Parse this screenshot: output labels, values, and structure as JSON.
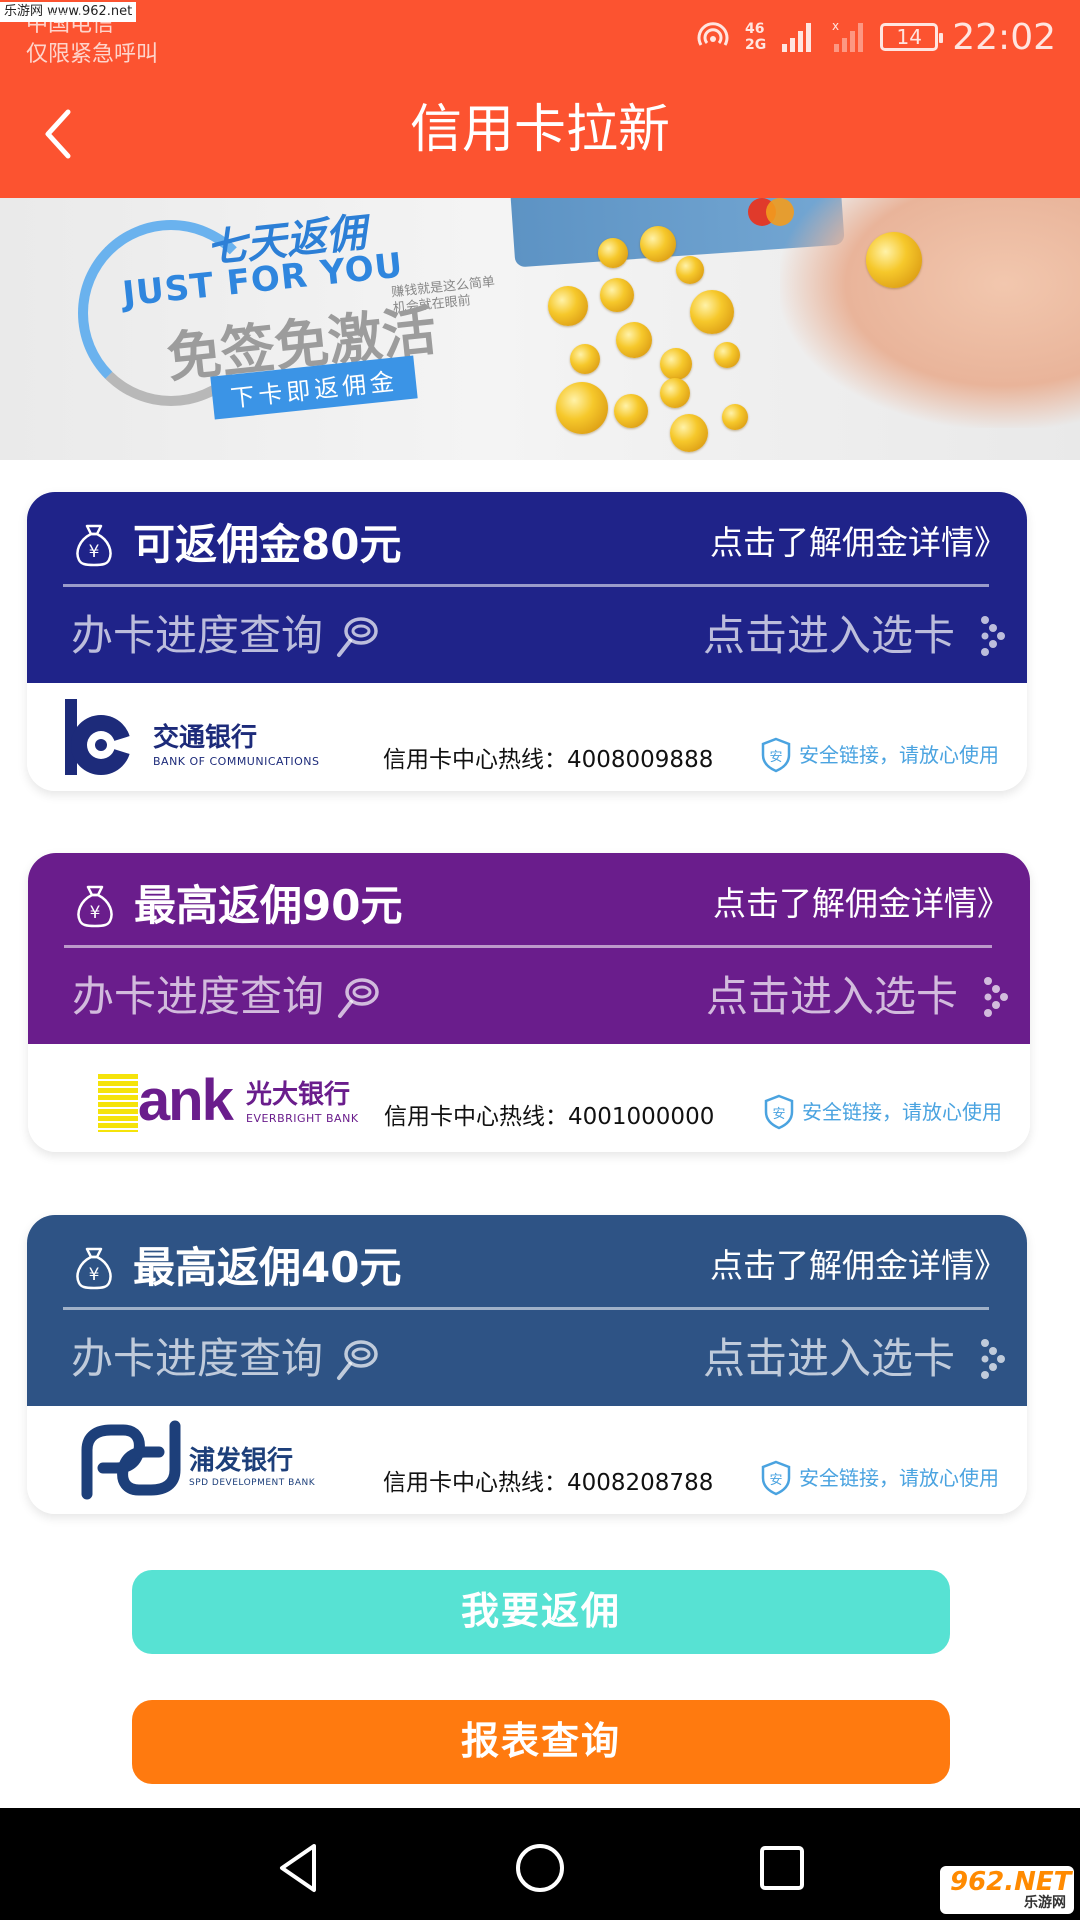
{
  "status_bar": {
    "watermark": "乐游网 www.962.net",
    "carrier": "中国电信",
    "emergency": "仅限紧急呼叫",
    "signal_top": "46",
    "signal_bottom": "2G",
    "battery": "14",
    "time": "22:02"
  },
  "header": {
    "title": "信用卡拉新",
    "back_icon": "chevron-left-icon"
  },
  "banner": {
    "title_cn": "七天返佣",
    "title_en": "JUST FOR YOU",
    "small_text": "赚钱就是这么简单\n机会就在眼前",
    "headline": "免签免激活",
    "tag": "下卡即返佣金"
  },
  "cards": [
    {
      "commission": "可返佣金80元",
      "detail_link": "点击了解佣金详情》",
      "progress_label": "办卡进度查询",
      "select_label": "点击进入选卡",
      "bank_name": "交通银行",
      "bank_en": "BANK OF COMMUNICATIONS",
      "hotline": "信用卡中心热线：4008009888",
      "secure_text": "安全链接，请放心使用",
      "color": "#1f2389"
    },
    {
      "commission": "最高返佣90元",
      "detail_link": "点击了解佣金详情》",
      "progress_label": "办卡进度查询",
      "select_label": "点击进入选卡",
      "bank_logo_text": "Bank",
      "bank_name": "光大银行",
      "bank_en": "EVERBRIGHT BANK",
      "hotline": "信用卡中心热线：4001000000",
      "secure_text": "安全链接，请放心使用",
      "color": "#6a1d8c"
    },
    {
      "commission": "最高返佣40元",
      "detail_link": "点击了解佣金详情》",
      "progress_label": "办卡进度查询",
      "select_label": "点击进入选卡",
      "bank_name": "浦发银行",
      "bank_en": "SPD DEVELOPMENT BANK",
      "hotline": "信用卡中心热线：4008208788",
      "secure_text": "安全链接，请放心使用",
      "color": "#2e5385"
    }
  ],
  "buttons": {
    "rebate": "我要返佣",
    "report": "报表查询"
  },
  "watermark_badge": {
    "main": "962.NET",
    "sub": "乐游网"
  }
}
